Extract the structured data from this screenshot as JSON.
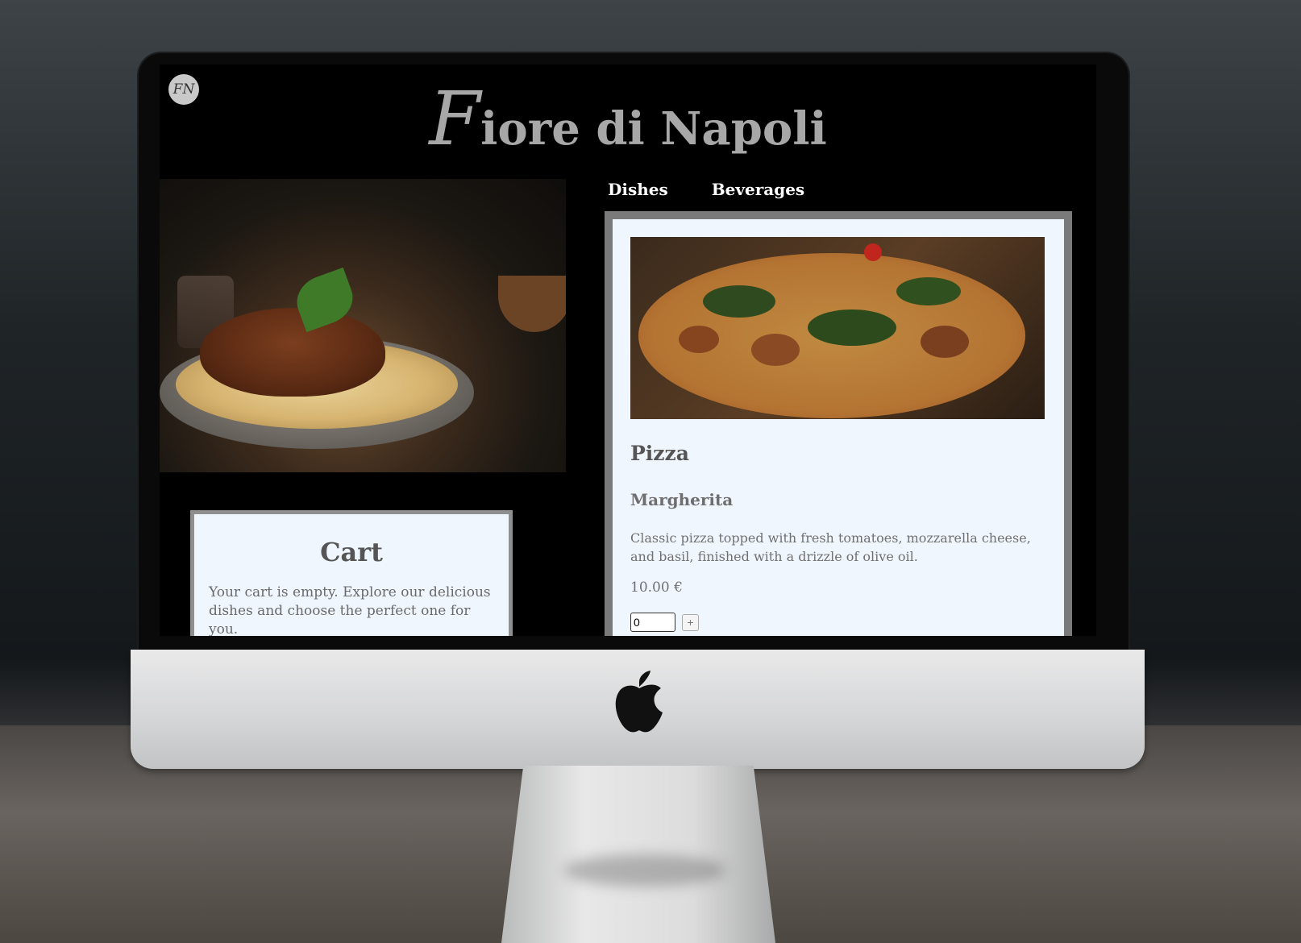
{
  "site": {
    "logo_monogram": "FN",
    "title_first": "F",
    "title_rest": "iore di Napoli"
  },
  "nav": {
    "tabs": [
      {
        "label": "Dishes"
      },
      {
        "label": "Beverages"
      }
    ]
  },
  "cart": {
    "title": "Cart",
    "empty_message": "Your cart is empty. Explore our delicious dishes and choose the perfect one for you."
  },
  "menu": {
    "category": "Pizza",
    "item": {
      "name": "Margherita",
      "description": "Classic pizza topped with fresh tomatoes, mozzarella cheese, and basil, finished with a drizzle of olive oil.",
      "price": "10.00 €",
      "quantity": "0",
      "add_label": "+"
    }
  },
  "colors": {
    "page_background": "#000000",
    "card_background": "#f0f6fe",
    "card_border": "#7a7a7a",
    "title_color": "#a7a7a7"
  },
  "icons": {
    "logo": "monogram-badge-icon",
    "hardware_logo": "apple-logo-icon"
  }
}
